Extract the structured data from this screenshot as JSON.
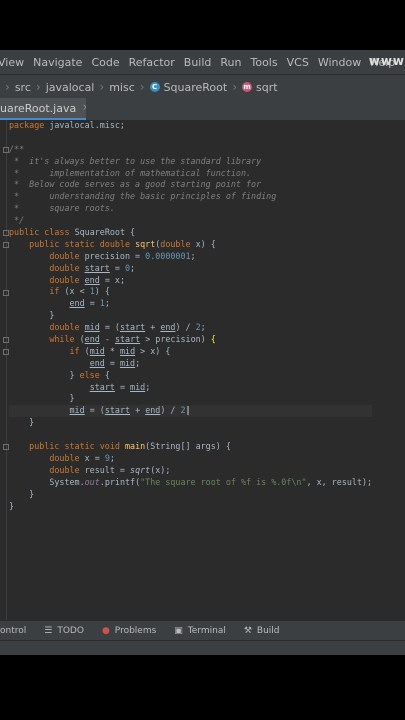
{
  "menu": {
    "items": [
      "View",
      "Navigate",
      "Code",
      "Refactor",
      "Build",
      "Run",
      "Tools",
      "VCS",
      "Window",
      "Help"
    ],
    "logo": "www"
  },
  "nav": {
    "crumbs": [
      "src",
      "javalocal",
      "misc",
      "SquareRoot",
      "sqrt"
    ]
  },
  "tab": {
    "label": "uareRoot.java",
    "close": "×"
  },
  "status": {
    "items": [
      "ontrol",
      "TODO",
      "Problems",
      "Terminal",
      "Build"
    ]
  },
  "code": {
    "lines": [
      "package javalocal.misc;",
      "",
      "/**",
      " *  it's always better to use the standard library",
      " *      implementation of mathematical function.",
      " *  Below code serves as a good starting point for",
      " *      understanding the basic principles of finding",
      " *      square roots.",
      " */",
      "public class SquareRoot {",
      "    public static double sqrt(double x) {",
      "        double precision = 0.0000001;",
      "        double start = 0;",
      "        double end = x;",
      "        if (x < 1) {",
      "            end = 1;",
      "        }",
      "        double mid = (start + end) / 2;",
      "        while (end - start > precision) {",
      "            if (mid * mid > x) {",
      "                end = mid;",
      "            } else {",
      "                start = mid;",
      "            }",
      "            mid = (start + end) / 2",
      "    }",
      "",
      "    public static void main(String[] args) {",
      "        double x = 9;",
      "        double result = sqrt(x);",
      "        System.out.printf(\"The square root of %f is %.0f\\n\", x, result);",
      "    }",
      "}"
    ]
  }
}
